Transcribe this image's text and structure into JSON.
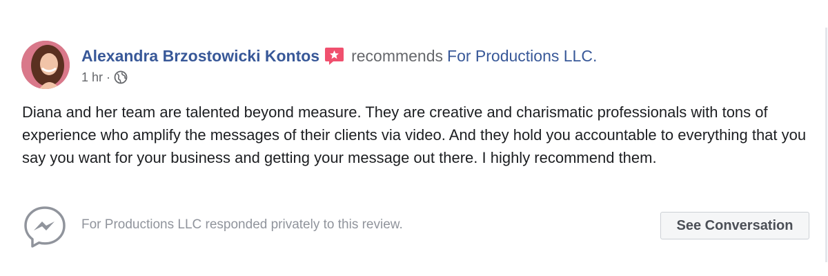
{
  "review": {
    "author_name": "Alexandra Brzostowicki Kontos",
    "action_text": "recommends",
    "page_name": "For Productions LLC.",
    "timestamp": "1 hr",
    "separator": "·",
    "privacy_icon": "globe-icon",
    "badge_icon": "recommendation-star-icon",
    "body": "Diana and her team are talented beyond measure. They are creative and charismatic professionals with tons of experience who amplify the messages of their clients via video. And they hold you accountable to everything that you say you want for your business and getting your message out there. I highly recommend them."
  },
  "response": {
    "icon": "messenger-icon",
    "text": "For Productions LLC responded privately to this review.",
    "button_label": "See Conversation"
  },
  "colors": {
    "link": "#385898",
    "secondary_text": "#65676b",
    "body_text": "#1c1e21",
    "badge": "#f0506e",
    "button_bg": "#f5f6f7"
  }
}
